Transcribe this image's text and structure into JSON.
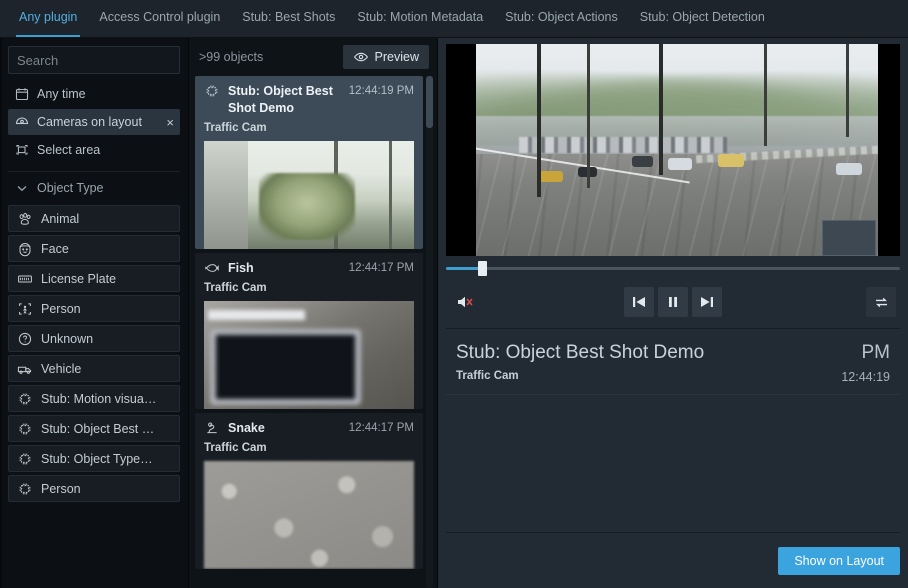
{
  "tabs": [
    {
      "label": "Any plugin",
      "active": true
    },
    {
      "label": "Access Control plugin",
      "active": false
    },
    {
      "label": "Stub: Best Shots",
      "active": false
    },
    {
      "label": "Stub: Motion Metadata",
      "active": false
    },
    {
      "label": "Stub: Object Actions",
      "active": false
    },
    {
      "label": "Stub: Object Detection",
      "active": false
    }
  ],
  "sidebar": {
    "search": {
      "value": "",
      "placeholder": "Search"
    },
    "filters": [
      {
        "label": "Any time",
        "icon": "calendar-icon",
        "chip": false
      },
      {
        "label": "Cameras on layout",
        "icon": "camera-icon",
        "chip": true,
        "close": "×"
      },
      {
        "label": "Select area",
        "icon": "select-area-icon",
        "chip": false
      }
    ],
    "section": {
      "label": "Object Type",
      "icon": "chevron-down-icon"
    },
    "object_types": [
      {
        "label": "Animal",
        "icon": "paw-icon"
      },
      {
        "label": "Face",
        "icon": "face-icon"
      },
      {
        "label": "License Plate",
        "icon": "license-plate-icon"
      },
      {
        "label": "Person",
        "icon": "person-icon"
      },
      {
        "label": "Unknown",
        "icon": "question-icon"
      },
      {
        "label": "Vehicle",
        "icon": "vehicle-icon"
      },
      {
        "label": "Stub: Motion visua…",
        "icon": "chip-icon"
      },
      {
        "label": "Stub: Object Best …",
        "icon": "chip-icon"
      },
      {
        "label": "Stub: Object Type…",
        "icon": "chip-icon"
      },
      {
        "label": "Person",
        "icon": "chip-icon"
      }
    ]
  },
  "results": {
    "count_label": ">99 objects",
    "preview_button": "Preview",
    "cards": [
      {
        "title": "Stub: Object Best Shot Demo",
        "time": "12:44:19 PM",
        "camera": "Traffic Cam",
        "icon": "chip-icon",
        "selected": true,
        "thumb": "thumb-a"
      },
      {
        "title": "Fish",
        "time": "12:44:17 PM",
        "camera": "Traffic Cam",
        "icon": "fish-icon",
        "selected": false,
        "thumb": "thumb-b"
      },
      {
        "title": "Snake",
        "time": "12:44:17 PM",
        "camera": "Traffic Cam",
        "icon": "snake-icon",
        "selected": false,
        "thumb": "thumb-c"
      }
    ]
  },
  "preview": {
    "player": {
      "seek_percent": 8,
      "mute_icon": "speaker-muted-icon",
      "prev_icon": "skip-previous-icon",
      "play_icon": "pause-icon",
      "next_icon": "skip-next-icon",
      "loop_icon": "repeat-icon"
    },
    "detail": {
      "title": "Stub: Object Best Shot Demo",
      "camera": "Traffic Cam",
      "ampm": "PM",
      "clock": "12:44:19"
    },
    "footer": {
      "show_on_layout": "Show on Layout"
    }
  },
  "colors": {
    "accent": "#3ba3dd",
    "tab_active": "#54aee0",
    "panel_bg": "#222b33",
    "sidebar_bg": "#0c1014",
    "card_selected": "#3c4b57"
  }
}
